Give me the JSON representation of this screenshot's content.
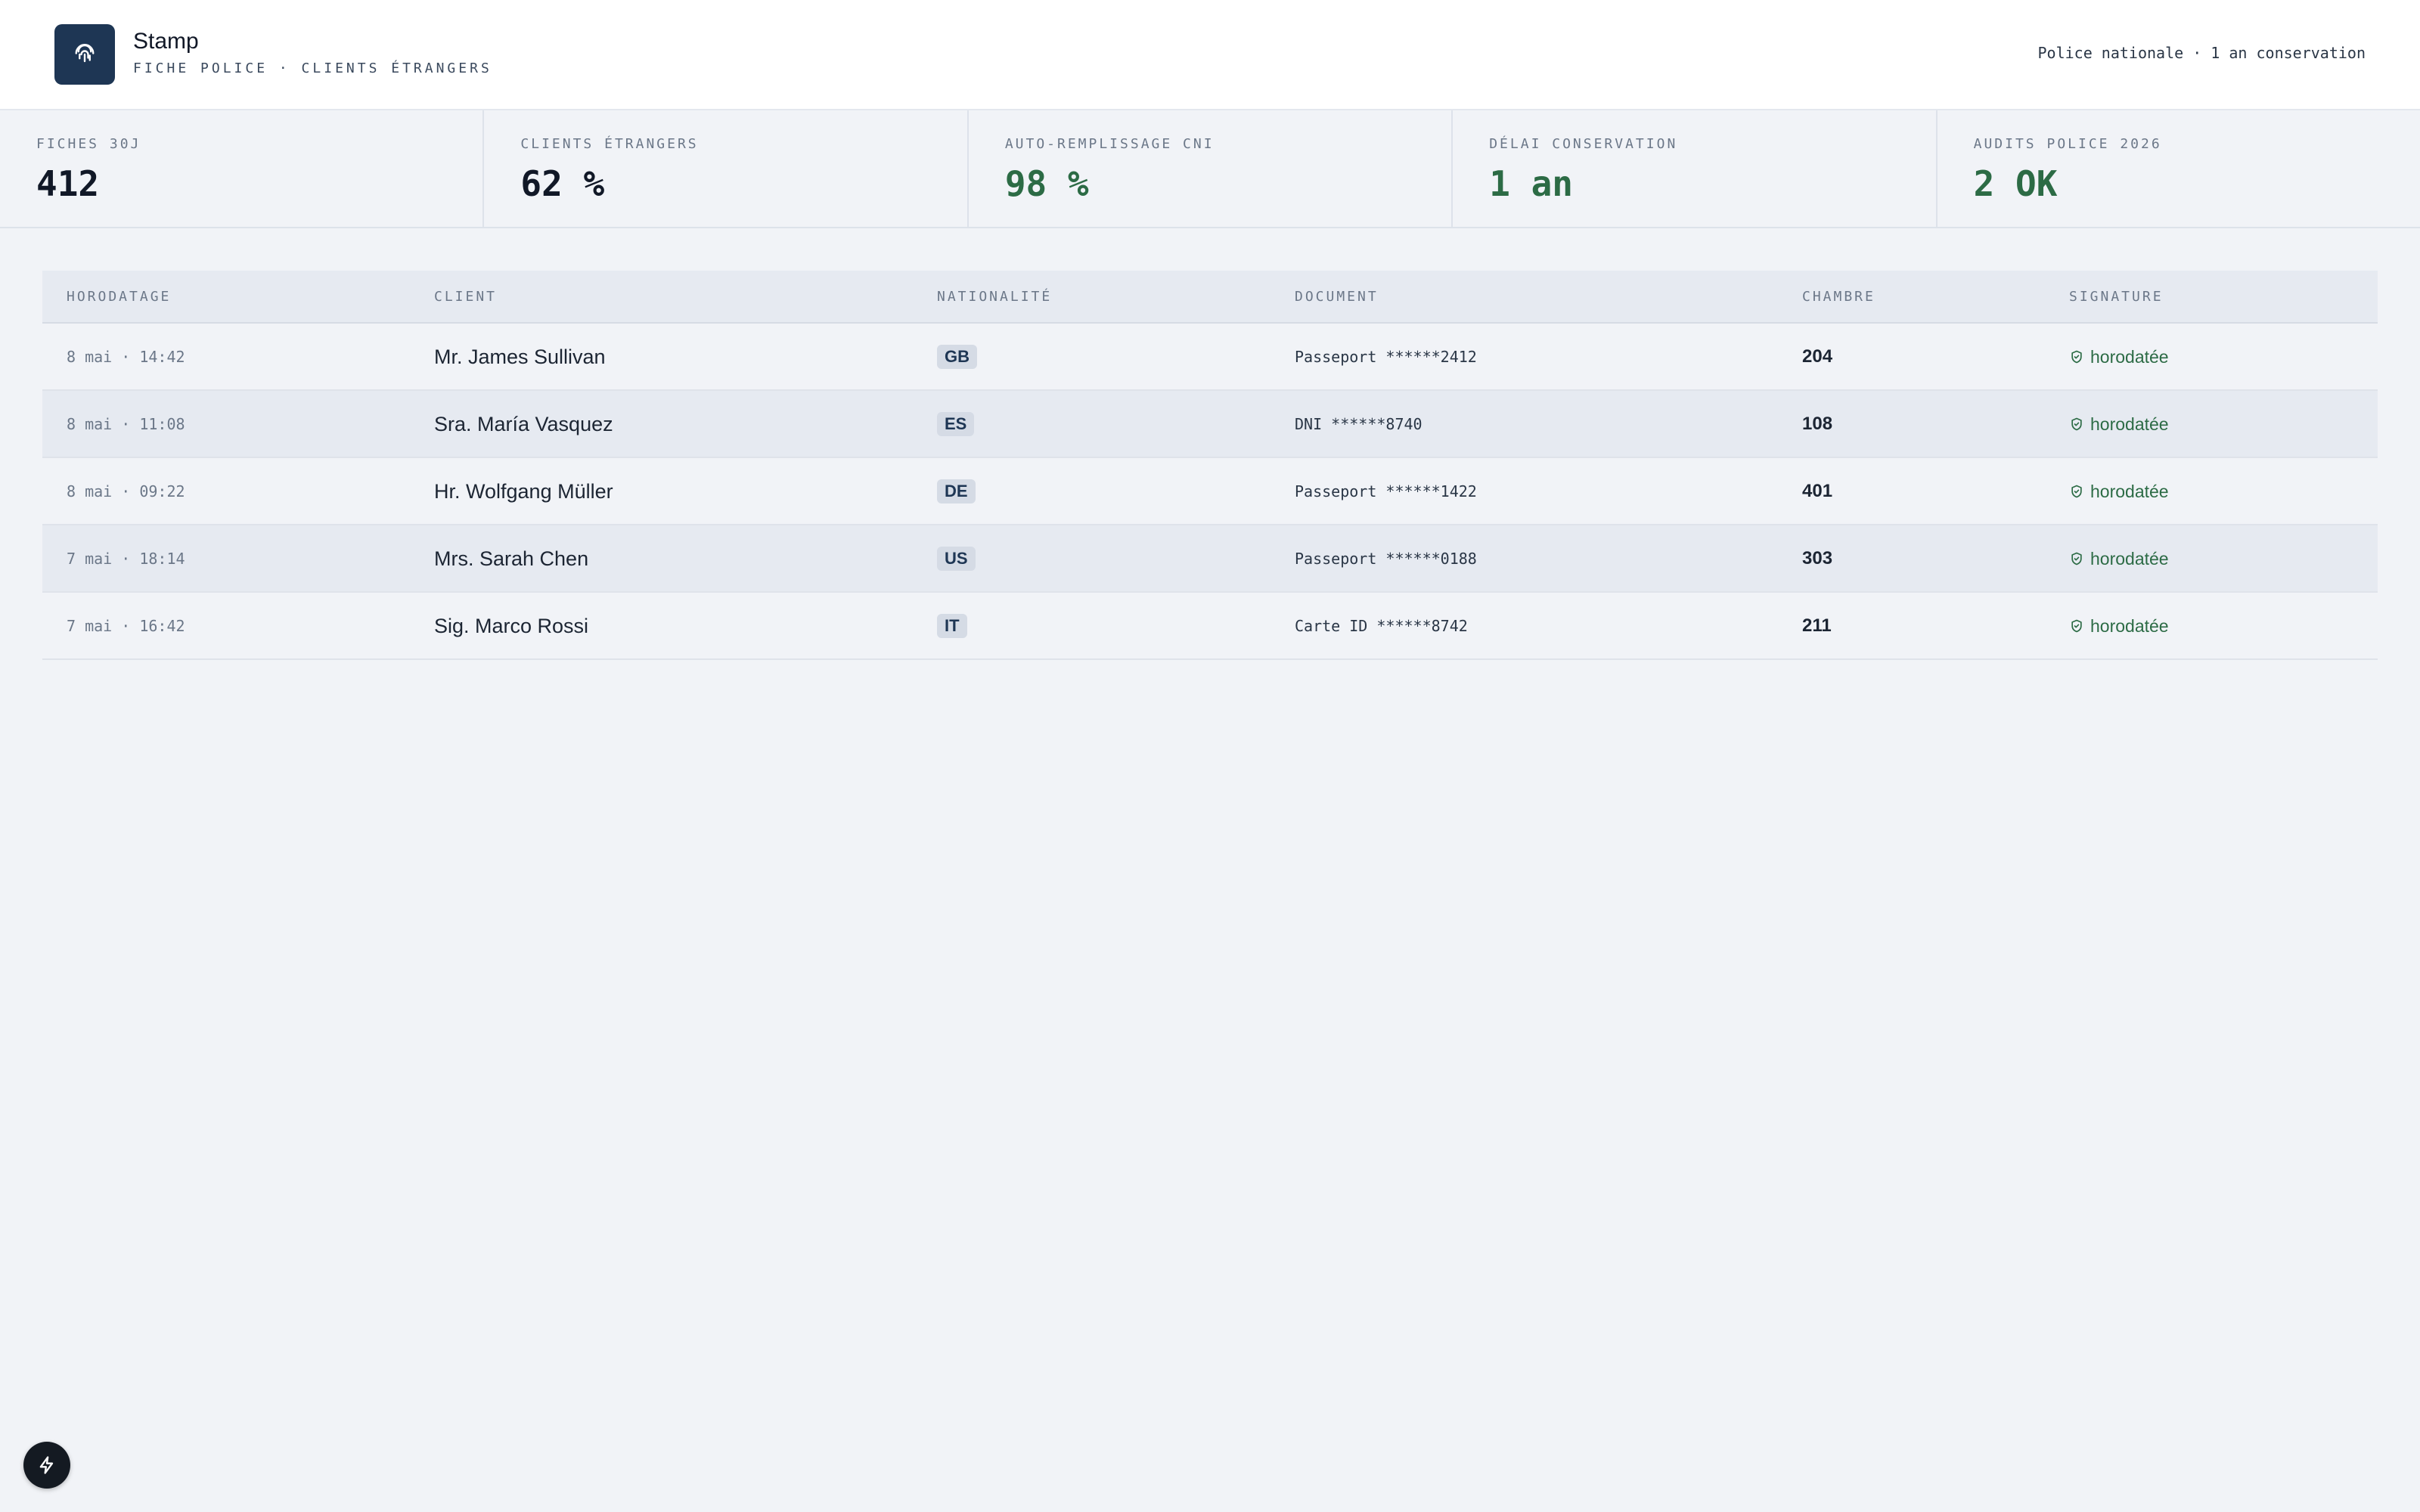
{
  "header": {
    "app_title": "Stamp",
    "app_subtitle": "FICHE POLICE · CLIENTS ÉTRANGERS",
    "right_info": "Police nationale · 1 an conservation",
    "logo_icon": "fingerprint-icon"
  },
  "stats": [
    {
      "label": "FICHES 30J",
      "value": "412",
      "accent": "#111827"
    },
    {
      "label": "CLIENTS ÉTRANGERS",
      "value": "62 %",
      "accent": "#111827"
    },
    {
      "label": "AUTO-REMPLISSAGE CNI",
      "value": "98 %",
      "accent": "#2c6b45"
    },
    {
      "label": "DÉLAI CONSERVATION",
      "value": "1 an",
      "accent": "#2c6b45"
    },
    {
      "label": "AUDITS POLICE 2026",
      "value": "2 OK",
      "accent": "#2c6b45"
    }
  ],
  "table": {
    "columns": [
      "HORODATAGE",
      "CLIENT",
      "NATIONALITÉ",
      "DOCUMENT",
      "CHAMBRE",
      "SIGNATURE"
    ],
    "rows": [
      {
        "time": "8 mai · 14:42",
        "client": "Mr. James Sullivan",
        "nationality": "GB",
        "document": "Passeport ******2412",
        "room": "204",
        "signature": "horodatée"
      },
      {
        "time": "8 mai · 11:08",
        "client": "Sra. María Vasquez",
        "nationality": "ES",
        "document": "DNI ******8740",
        "room": "108",
        "signature": "horodatée"
      },
      {
        "time": "8 mai · 09:22",
        "client": "Hr. Wolfgang Müller",
        "nationality": "DE",
        "document": "Passeport ******1422",
        "room": "401",
        "signature": "horodatée"
      },
      {
        "time": "7 mai · 18:14",
        "client": "Mrs. Sarah Chen",
        "nationality": "US",
        "document": "Passeport ******0188",
        "room": "303",
        "signature": "horodatée"
      },
      {
        "time": "7 mai · 16:42",
        "client": "Sig. Marco Rossi",
        "nationality": "IT",
        "document": "Carte ID ******8742",
        "room": "211",
        "signature": "horodatée"
      }
    ]
  },
  "colors": {
    "brand": "#1e3654",
    "success": "#2c6b45",
    "background": "#f1f3f7"
  },
  "fab_icon": "lightning-icon"
}
